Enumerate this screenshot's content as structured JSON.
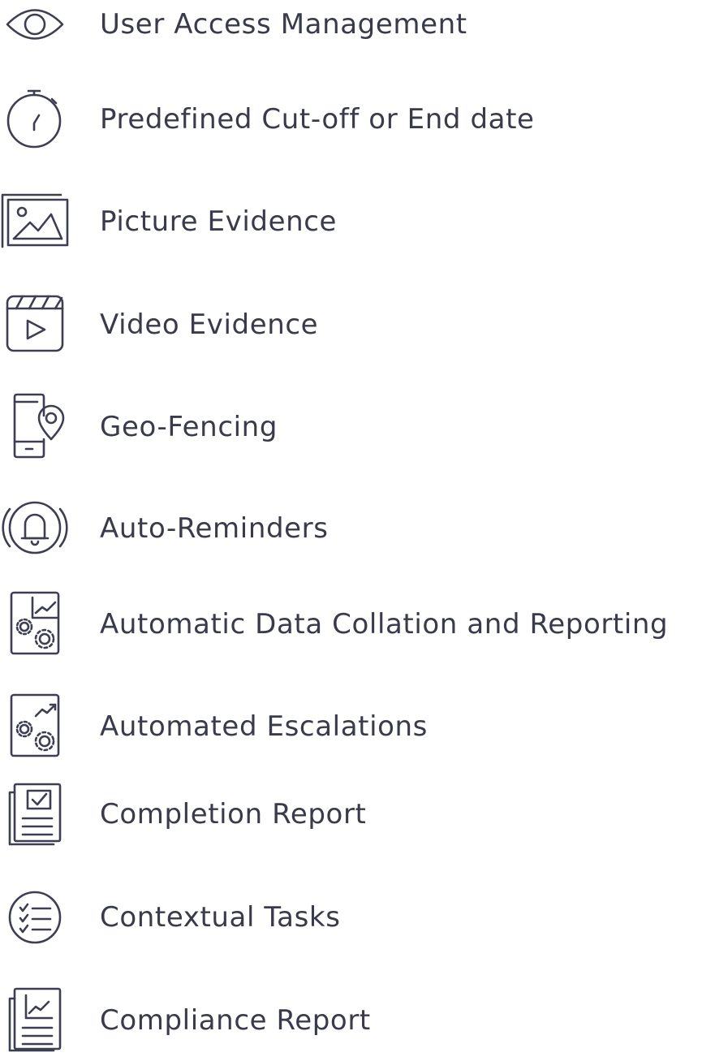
{
  "features": [
    {
      "label": "User Access Management",
      "icon": "eye-icon"
    },
    {
      "label": "Predefined Cut-off or End date",
      "icon": "stopwatch-icon"
    },
    {
      "label": "Picture Evidence",
      "icon": "image-icon"
    },
    {
      "label": "Video Evidence",
      "icon": "video-clapper-icon"
    },
    {
      "label": "Geo-Fencing",
      "icon": "phone-location-icon"
    },
    {
      "label": "Auto-Reminders",
      "icon": "bell-ringing-icon"
    },
    {
      "label": "Automatic Data Collation and Reporting",
      "icon": "gears-chart-icon"
    },
    {
      "label": "Automated Escalations",
      "icon": "gears-trend-icon"
    },
    {
      "label": "Completion Report",
      "icon": "checked-report-icon"
    },
    {
      "label": "Contextual Tasks",
      "icon": "checklist-circle-icon"
    },
    {
      "label": "Compliance Report",
      "icon": "chart-report-icon"
    }
  ]
}
